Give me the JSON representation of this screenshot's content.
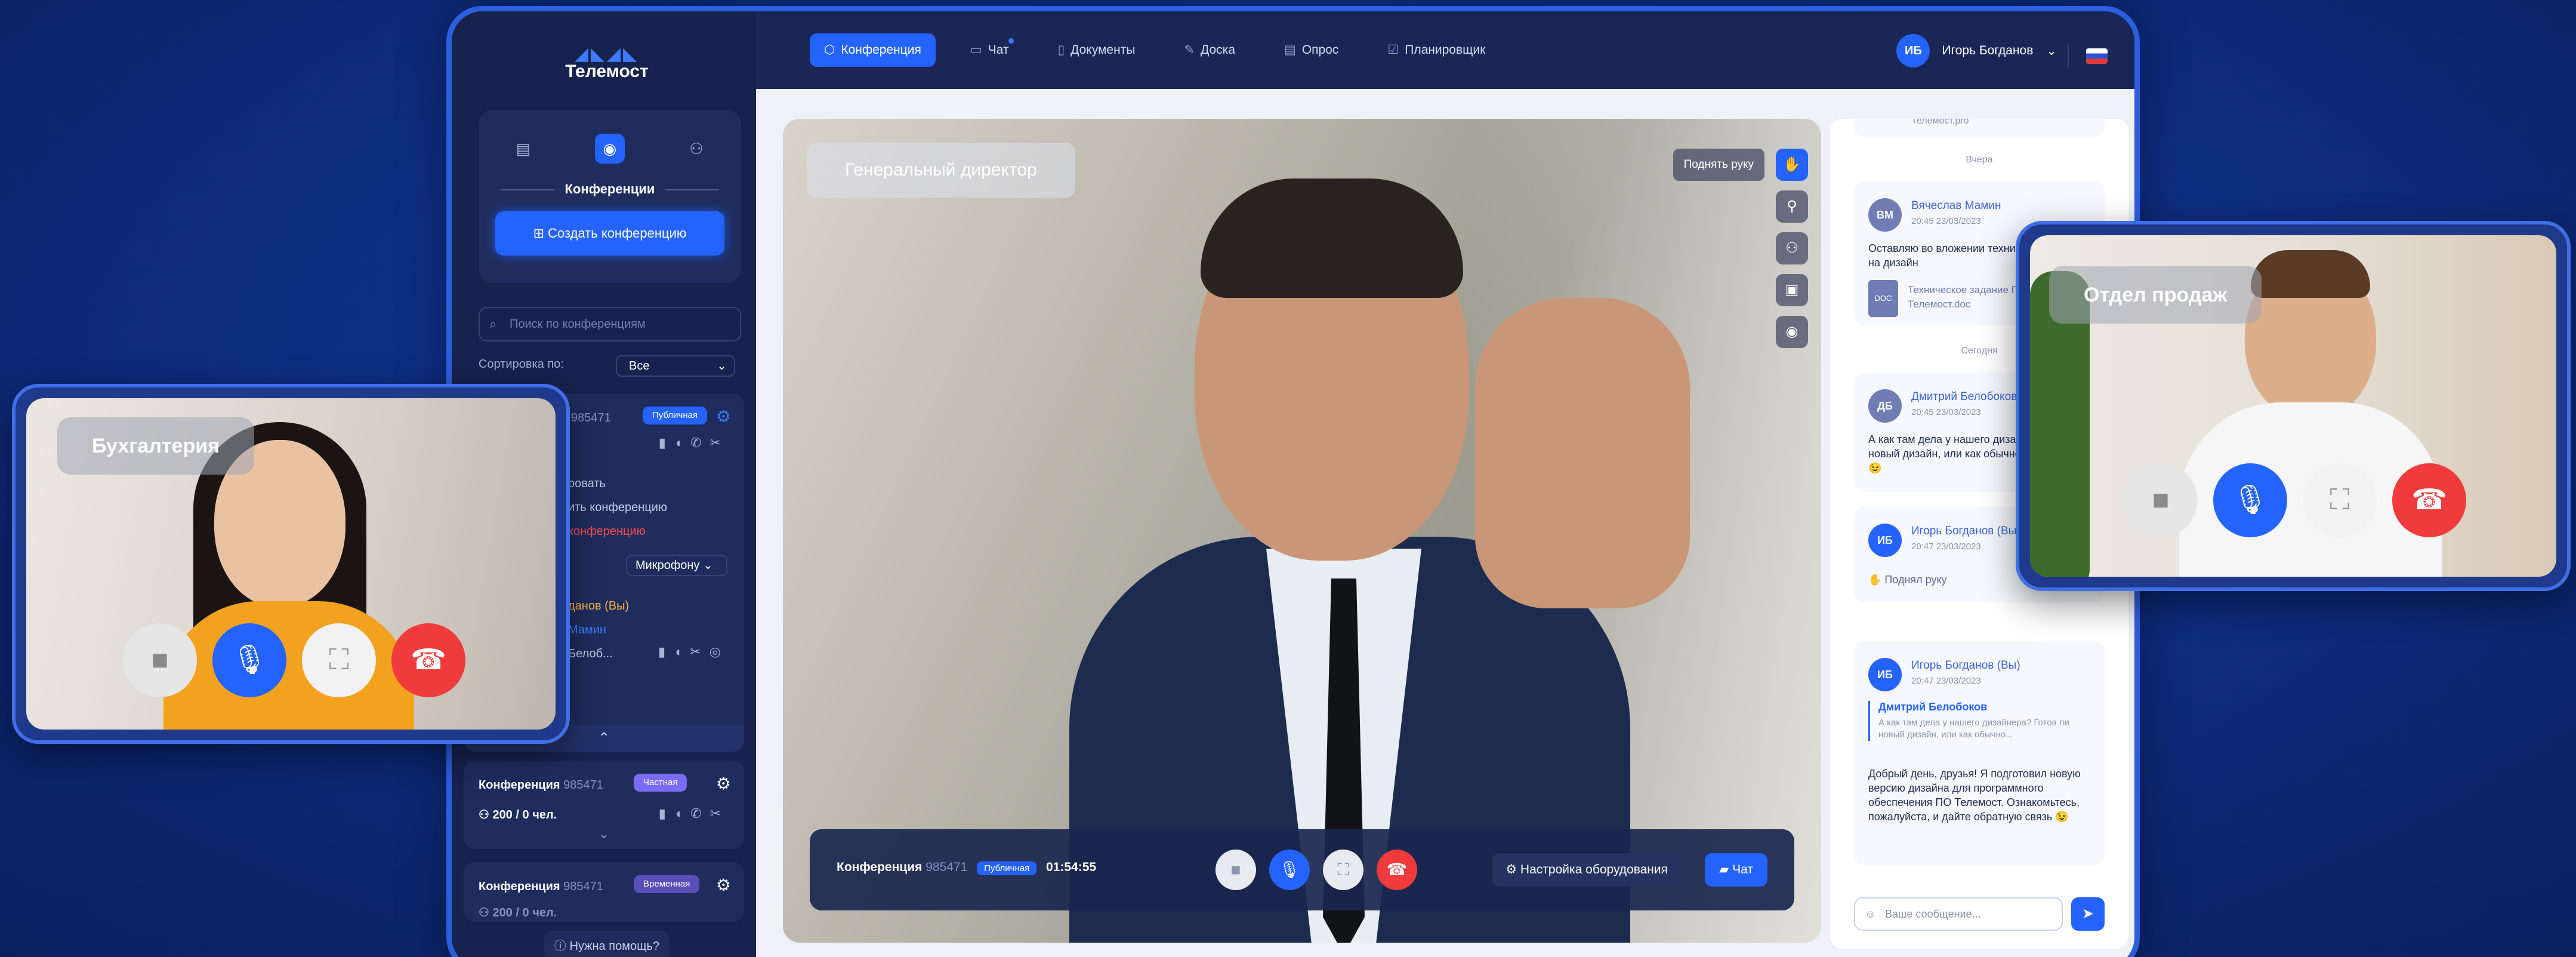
{
  "sidebar": {
    "logo": "Телемост",
    "section_label": "Конференции",
    "create_button": "Создать конференцию",
    "search_placeholder": "Поиск по конференциям",
    "sort_label": "Сортировка по:",
    "sort_value": "Все",
    "item1": {
      "id": "985471",
      "badge": "Публичная"
    },
    "expanded": {
      "line1": "ровать",
      "line2": "ить конференцию",
      "line3": "конференцию",
      "mic_label": "Микрофону",
      "line4": "данов (Вы)",
      "line5": "Мамин",
      "line6": "Белоб..."
    },
    "item2": {
      "title": "Конференция",
      "id": "985471",
      "badge": "Частная",
      "count": "200 / 0 чел."
    },
    "item3": {
      "title": "Конференция",
      "id": "985471",
      "badge": "Временная",
      "count": "200 / 0 чел."
    },
    "help": "Нужна помощь?"
  },
  "topbar": {
    "nav": [
      "Конференция",
      "Чат",
      "Документы",
      "Доска",
      "Опрос",
      "Планировщик"
    ],
    "user_initials": "ИБ",
    "user_name": "Игорь Богданов"
  },
  "video": {
    "label": "Генеральный директор",
    "raise_hand": "Поднять руку",
    "conference_label": "Конференция",
    "conference_id": "985471",
    "conference_badge": "Публичная",
    "timer": "01:54:55",
    "setup_button": "Настройка оборудования",
    "chat_button": "Чат"
  },
  "chat": {
    "top_fragment": "Телемост.pro",
    "day_yesterday": "Вчера",
    "day_today": "Сегодня",
    "messages": [
      {
        "initials": "ВМ",
        "name": "Вячеслав Мамин",
        "time": "20:45 23/03/2023",
        "text": "Оставляю во вложении техническое задание на дизайн",
        "file": "Техническое задание ПО Телемост.doc",
        "file_type": "DOC"
      },
      {
        "initials": "ДБ",
        "name": "Дмитрий Белобоков",
        "time": "20:45 23/03/2023",
        "text": "А как там дела у нашего дизайнера? Готов ли новый дизайн, или как обычно - переносится?😉"
      },
      {
        "initials": "ИБ",
        "name": "Игорь Богданов (Вы)",
        "time": "20:47 23/03/2023",
        "text": "Поднял руку"
      },
      {
        "initials": "ИБ",
        "name": "Игорь Богданов (Вы)",
        "time": "20:47 23/03/2023",
        "quote_name": "Дмитрий Белобоков",
        "quote_text": "А как там дела у нашего дизайнера? Готов ли новый дизайн, или как обычно...",
        "text": "Добрый день, друзья! Я подготовил новую версию дизайна для программного обеспечения ПО Телемост. Ознакомьтесь, пожалуйста, и дайте обратную связь 😉"
      }
    ],
    "input_placeholder": "Ваше сообщение..."
  },
  "float_left": {
    "label": "Бухгалтерия"
  },
  "float_right": {
    "label": "Отдел продаж"
  },
  "colors": {
    "accent": "#2563ff",
    "danger": "#ef3b3b",
    "frame": "#2b5fe0"
  }
}
